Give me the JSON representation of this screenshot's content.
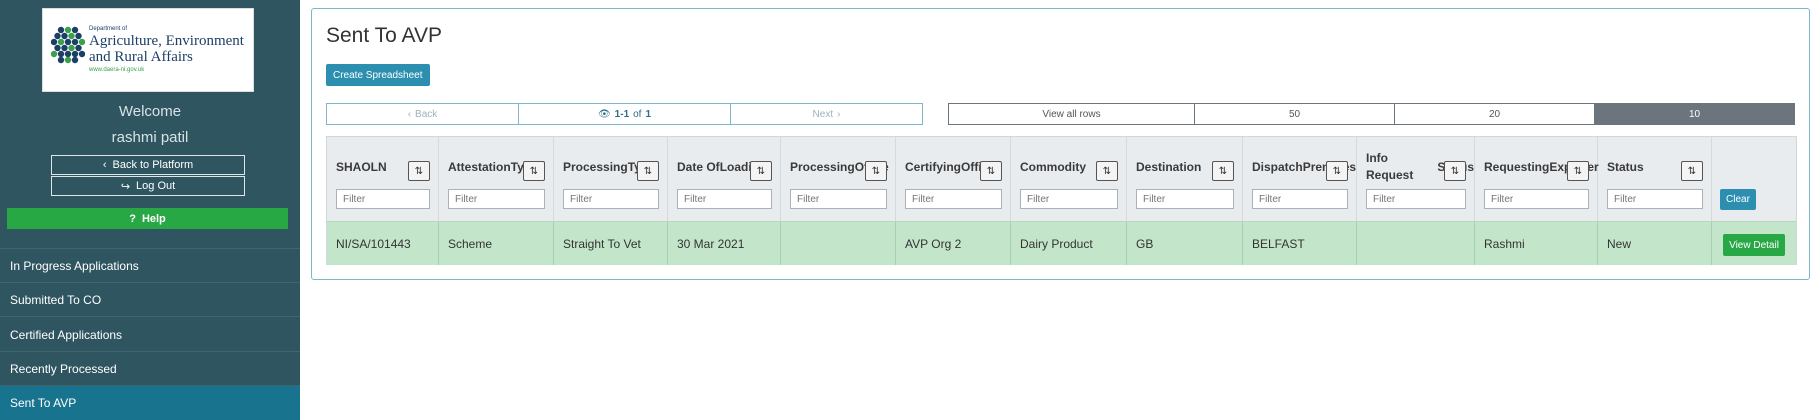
{
  "logo": {
    "dept_line": "Department of",
    "name_line1": "Agriculture, Environment",
    "name_line2": "and Rural Affairs",
    "url": "www.daera-ni.gov.uk"
  },
  "user": {
    "welcome": "Welcome",
    "name": "rashmi patil"
  },
  "sidebar": {
    "back_label": "Back to Platform",
    "logout_label": "Log Out",
    "help_label": "Help",
    "nav": [
      {
        "label": "In Progress Applications"
      },
      {
        "label": "Submitted To CO"
      },
      {
        "label": "Certified Applications"
      },
      {
        "label": "Recently Processed"
      },
      {
        "label": "Sent To AVP",
        "active": true
      }
    ]
  },
  "main": {
    "title": "Sent To AVP",
    "create_label": "Create Spreadsheet",
    "pager": {
      "back": "Back",
      "range": "1-1",
      "of": "of",
      "total": "1",
      "next": "Next"
    },
    "rows_options": {
      "all": "View all rows",
      "opt50": "50",
      "opt20": "20",
      "opt10": "10",
      "selected": "10"
    },
    "filter_placeholder": "Filter",
    "clear_label": "Clear",
    "view_detail_label": "View Detail",
    "columns": [
      {
        "line1": "SHAOLN",
        "line2": ""
      },
      {
        "line1": "Attestation",
        "line2": "Type"
      },
      {
        "line1": "Processing",
        "line2": "Type"
      },
      {
        "line1": "Date Of",
        "line2": "Loading"
      },
      {
        "line1": "Processing",
        "line2": "Office"
      },
      {
        "line1": "Certifying",
        "line2": "Officer"
      },
      {
        "line1": "Commodity",
        "line2": ""
      },
      {
        "line1": "Destination",
        "line2": ""
      },
      {
        "line1": "Dispatch",
        "line2": "Premises"
      },
      {
        "line1": "Info Request",
        "line2": "Status"
      },
      {
        "line1": "Requesting",
        "line2": "Exporter"
      },
      {
        "line1": "Status",
        "line2": ""
      }
    ],
    "rows": [
      [
        "NI/SA/101443",
        "Scheme",
        "Straight To Vet",
        "30 Mar 2021",
        "",
        "AVP Org 2",
        "Dairy Product",
        "GB",
        "BELFAST",
        "",
        "Rashmi",
        "New"
      ]
    ]
  },
  "colors": {
    "sidebar_bg": "#2e5560",
    "nav_active": "#17738e",
    "help_green": "#28a745",
    "primary_blue": "#2c8fb0",
    "row_green": "#c3e6cb"
  }
}
